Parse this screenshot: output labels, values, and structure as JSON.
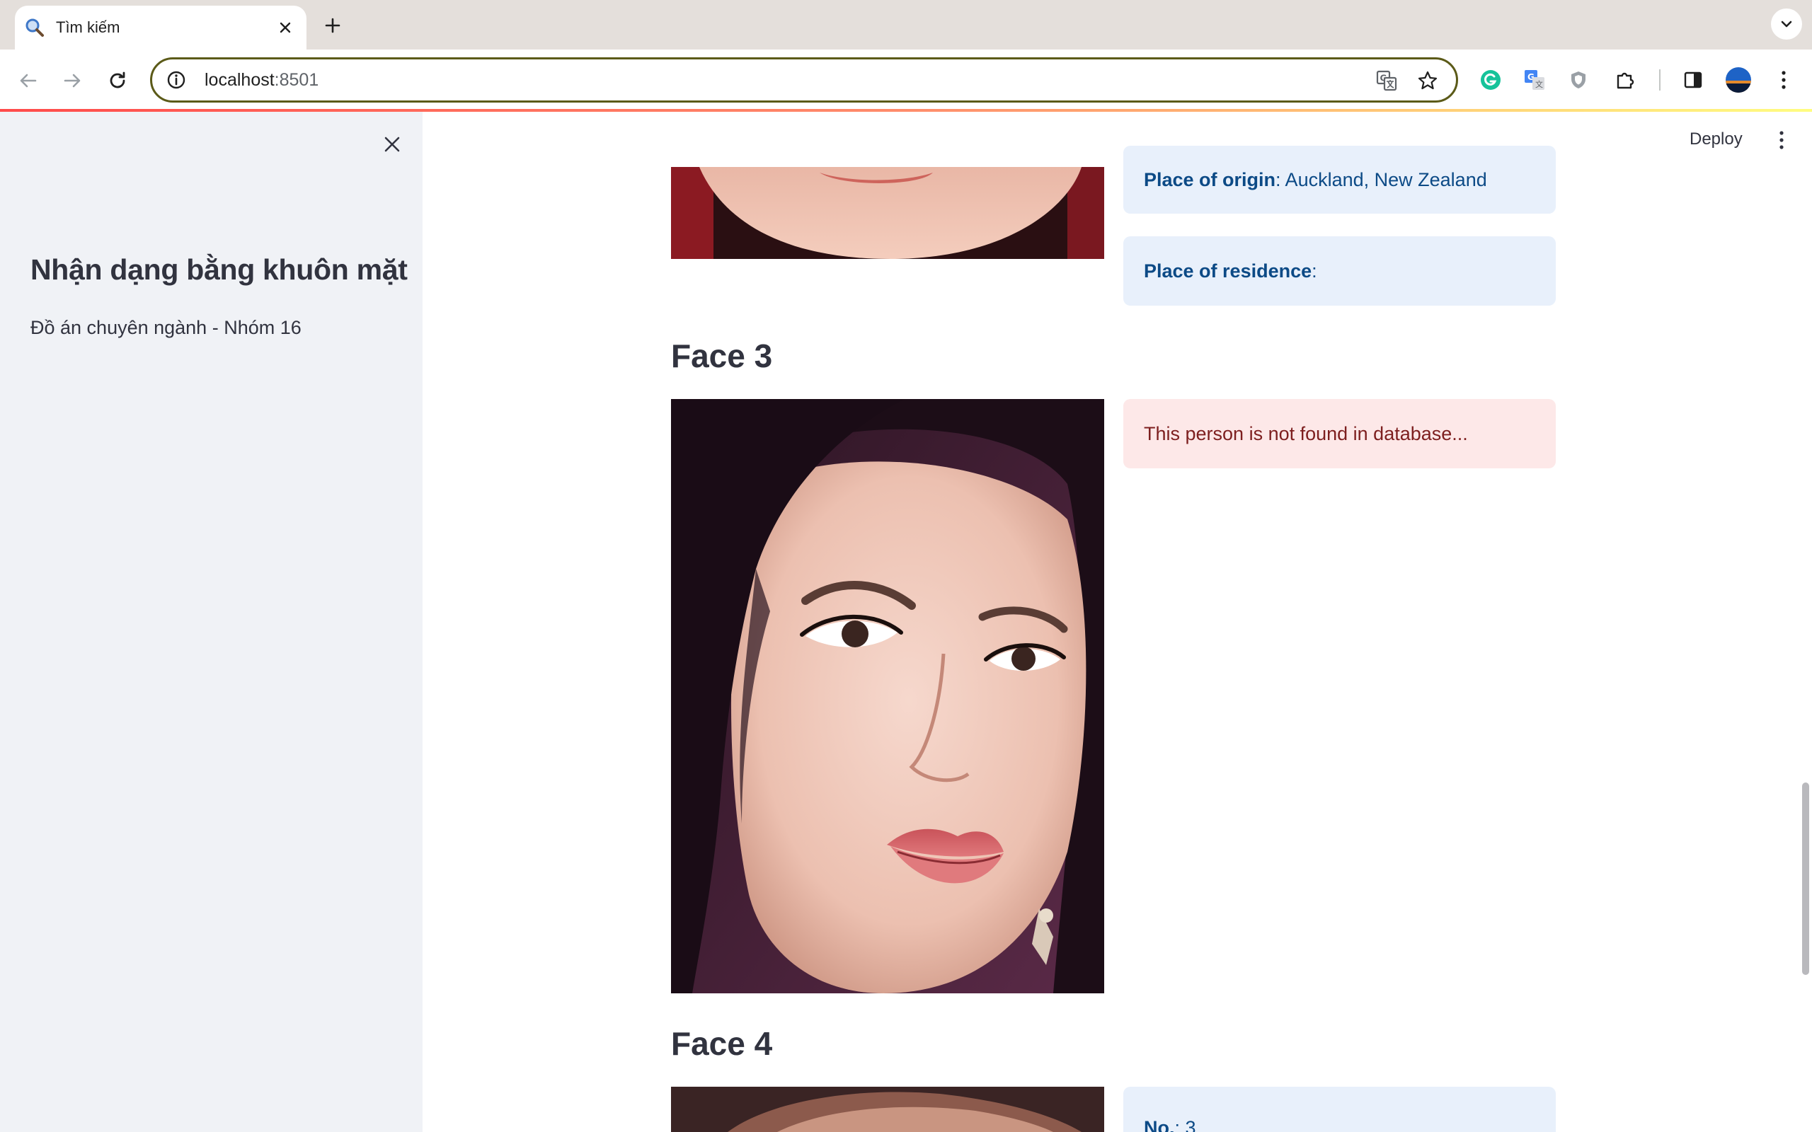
{
  "browser": {
    "tab_title": "Tìm kiếm",
    "url_host": "localhost",
    "url_port": ":8501"
  },
  "sidebar": {
    "title": "Nhận dạng bằng khuôn mặt",
    "subtitle": "Đồ án chuyên ngành - Nhóm 16"
  },
  "header": {
    "deploy_label": "Deploy"
  },
  "face2": {
    "origin_label": "Place of origin",
    "origin_value": ": Auckland, New Zealand",
    "residence_label": "Place of residence",
    "residence_value": ":"
  },
  "face3": {
    "heading": "Face 3",
    "message": "This person is not found in database..."
  },
  "face4": {
    "heading": "Face 4",
    "no_label": "No.",
    "no_value": ": 3"
  },
  "colors": {
    "accent": "#ff4b4b",
    "info_bg": "#e8f0fb",
    "info_text": "#0c4a86",
    "error_bg": "#fde8e8",
    "error_text": "#7d1f1f",
    "sidebar_bg": "#f0f2f6"
  },
  "icons": [
    "search-icon",
    "close-icon",
    "plus-icon",
    "chevron-down-icon",
    "back-arrow-icon",
    "forward-arrow-icon",
    "reload-icon",
    "info-icon",
    "translate-icon",
    "star-icon",
    "grammarly-icon",
    "google-translate-icon",
    "shield-icon",
    "puzzle-icon",
    "side-panel-icon",
    "avatar",
    "kebab-menu-icon"
  ]
}
